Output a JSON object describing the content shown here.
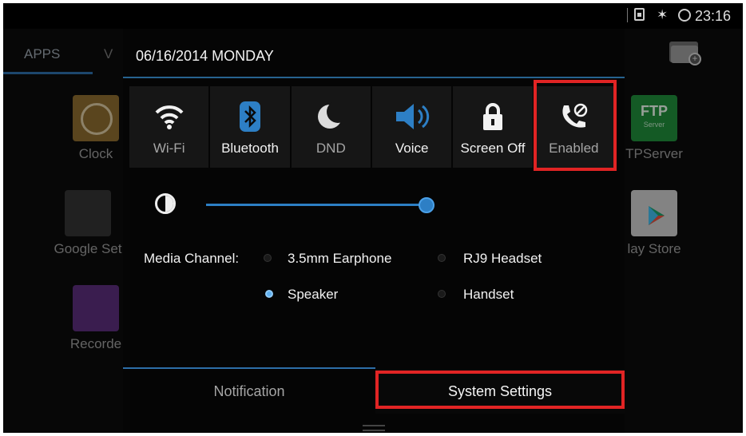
{
  "status_bar": {
    "time": "23:16",
    "icons": [
      "sim-icon",
      "bluetooth-icon",
      "sync-icon"
    ]
  },
  "launcher": {
    "tab_apps": "APPS",
    "tab_partial": "V",
    "apps_left": [
      {
        "label": "Clock",
        "icon": "clock-icon"
      },
      {
        "label": "Google Set",
        "icon": "google-settings-icon"
      },
      {
        "label": "Recorde",
        "icon": "recorder-icon"
      }
    ],
    "apps_right": [
      {
        "label": "TPServer",
        "icon": "ftp-server-icon",
        "tile_text": "FTP",
        "tile_sub": "Server"
      },
      {
        "label": "lay Store",
        "icon": "play-store-icon"
      }
    ]
  },
  "panel": {
    "date": "06/16/2014 MONDAY",
    "toggles": [
      {
        "label": "Wi-Fi",
        "icon": "wifi-icon",
        "state": "off"
      },
      {
        "label": "Bluetooth",
        "icon": "bluetooth-icon",
        "state": "on"
      },
      {
        "label": "DND",
        "icon": "moon-icon",
        "state": "off"
      },
      {
        "label": "Voice",
        "icon": "speaker-icon",
        "state": "on"
      },
      {
        "label": "Screen Off",
        "icon": "lock-icon",
        "state": "on"
      },
      {
        "label": "Enabled",
        "icon": "phone-blocked-icon",
        "state": "off"
      }
    ],
    "brightness": {
      "icon": "brightness-icon",
      "level": 1.0
    },
    "media": {
      "label": "Media Channel:",
      "options": [
        {
          "label": "3.5mm Earphone",
          "selected": false
        },
        {
          "label": "RJ9 Headset",
          "selected": false
        },
        {
          "label": "Speaker",
          "selected": true
        },
        {
          "label": "Handset",
          "selected": false
        }
      ]
    },
    "tabs": {
      "notification": "Notification",
      "system_settings": "System Settings"
    }
  },
  "colors": {
    "accent": "#2d7fc5",
    "highlight": "#e12424"
  }
}
